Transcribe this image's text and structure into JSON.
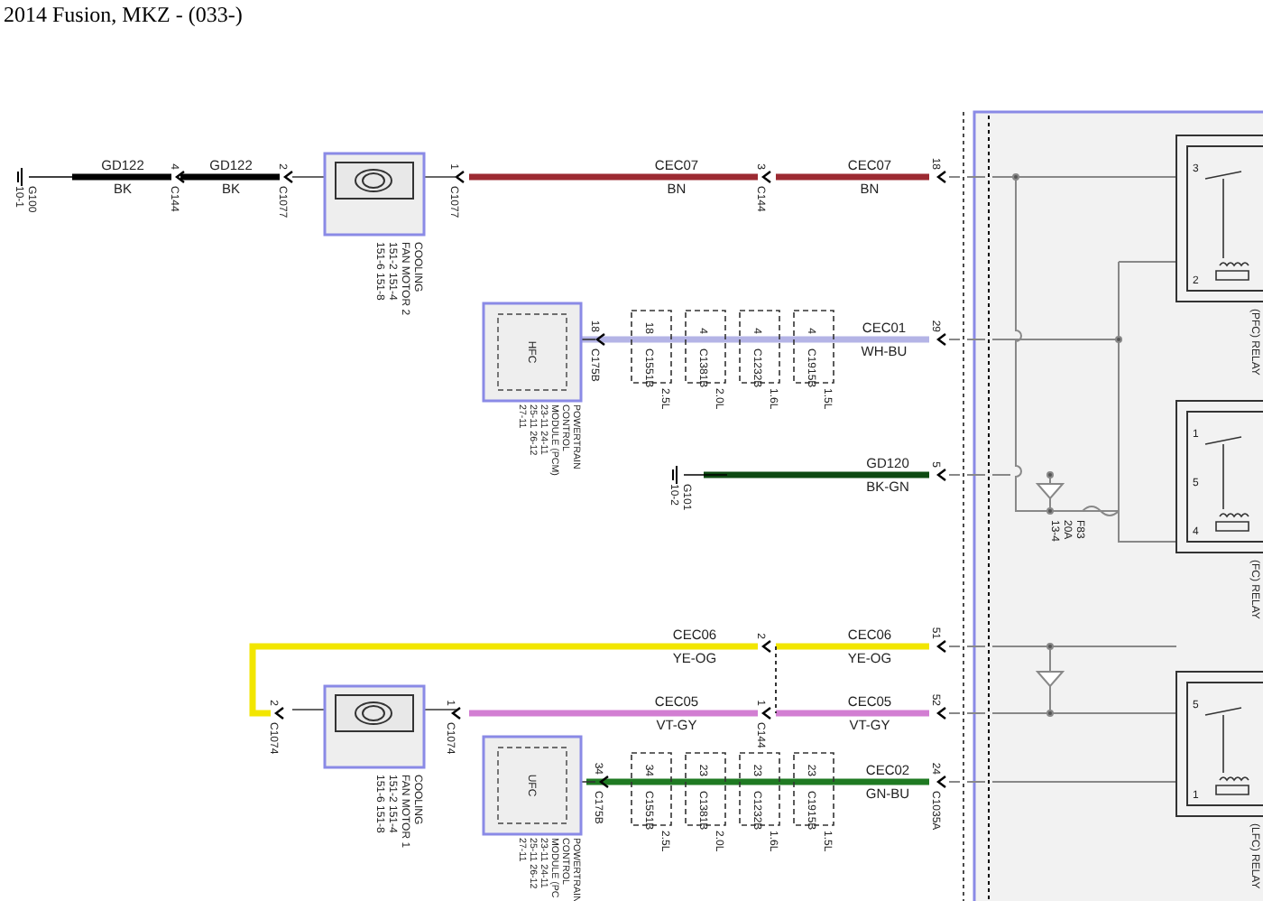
{
  "title": "2014 Fusion, MKZ - (033-)",
  "wires": [
    {
      "circuit": "GD122",
      "color_code": "BK",
      "color": "#000000"
    },
    {
      "circuit": "GD122",
      "color_code": "BK",
      "color": "#000000"
    },
    {
      "circuit": "CEC07",
      "color_code": "BN",
      "color": "#9c2a32"
    },
    {
      "circuit": "CEC07",
      "color_code": "BN",
      "color": "#9c2a32"
    },
    {
      "circuit": "CEC01",
      "color_code": "WH-BU",
      "color": "#b4b4e6"
    },
    {
      "circuit": "GD120",
      "color_code": "BK-GN",
      "color": "#0e4a12"
    },
    {
      "circuit": "CEC06",
      "color_code": "YE-OG",
      "color": "#f2e600"
    },
    {
      "circuit": "CEC06",
      "color_code": "YE-OG",
      "color": "#f2e600"
    },
    {
      "circuit": "CEC05",
      "color_code": "VT-GY",
      "color": "#d27ed2"
    },
    {
      "circuit": "CEC05",
      "color_code": "VT-GY",
      "color": "#d27ed2"
    },
    {
      "circuit": "CEC02",
      "color_code": "GN-BU",
      "color": "#1f7a22"
    }
  ],
  "pins": [
    {
      "number": "4",
      "connector": "C144"
    },
    {
      "number": "2",
      "connector": "C1077"
    },
    {
      "number": "1",
      "connector": "C1077"
    },
    {
      "number": "3",
      "connector": "C144"
    },
    {
      "number": "18"
    },
    {
      "number": "18",
      "connector": "C175B"
    },
    {
      "number": "29"
    },
    {
      "number": "5"
    },
    {
      "number": "2",
      "connector": "C1074"
    },
    {
      "number": "1",
      "connector": "C1074"
    },
    {
      "number": "2"
    },
    {
      "number": "51"
    },
    {
      "number": "1",
      "connector": "C144"
    },
    {
      "number": "52"
    },
    {
      "number": "34",
      "connector": "C175B"
    },
    {
      "number": "24",
      "connector": "C1035A"
    }
  ],
  "grounds": [
    {
      "name": "G100",
      "ref": "10-1"
    },
    {
      "name": "G101",
      "ref": "10-2"
    }
  ],
  "motors": [
    {
      "lines": [
        "COOLING",
        "FAN MOTOR 2",
        "151-2  151-4",
        "151-6  151-8"
      ]
    },
    {
      "lines": [
        "COOLING",
        "FAN MOTOR 1",
        "151-2  151-4",
        "151-6  151-8"
      ]
    }
  ],
  "modules": [
    {
      "tag": "HFC",
      "lines": [
        "POWERTRAIN",
        "CONTROL",
        "MODULE (PCM)",
        "23-11  24-11",
        "25-11  26-12",
        "27-11"
      ]
    },
    {
      "tag": "UFC",
      "lines": [
        "POWERTRAIN",
        "CONTROL",
        "MODULE (PC",
        "23-11  24-11",
        "25-11  26-12",
        "27-11"
      ]
    }
  ],
  "splice_packs": [
    [
      {
        "pin": "18",
        "connector": "C1551B",
        "engine": "2.5L"
      },
      {
        "pin": "4",
        "connector": "C1381B",
        "engine": "2.0L"
      },
      {
        "pin": "4",
        "connector": "C1232B",
        "engine": "1.6L"
      },
      {
        "pin": "4",
        "connector": "C1915B",
        "engine": "1.5L"
      }
    ],
    [
      {
        "pin": "34",
        "connector": "C1551B",
        "engine": "2.5L"
      },
      {
        "pin": "23",
        "connector": "C1381B",
        "engine": "2.0L"
      },
      {
        "pin": "23",
        "connector": "C1232B",
        "engine": "1.6L"
      },
      {
        "pin": "23",
        "connector": "C1915B",
        "engine": "1.5L"
      }
    ]
  ],
  "relays": [
    {
      "label": "(PFC) RELAY",
      "pins": [
        "3",
        "2"
      ]
    },
    {
      "label": "(FC) RELAY",
      "pins": [
        "1",
        "5",
        "4"
      ]
    },
    {
      "label": "(LFC) RELAY",
      "pins": [
        "5",
        "1"
      ]
    }
  ],
  "fuse": {
    "name": "F83",
    "rating": "20A",
    "ref": "13-4"
  }
}
